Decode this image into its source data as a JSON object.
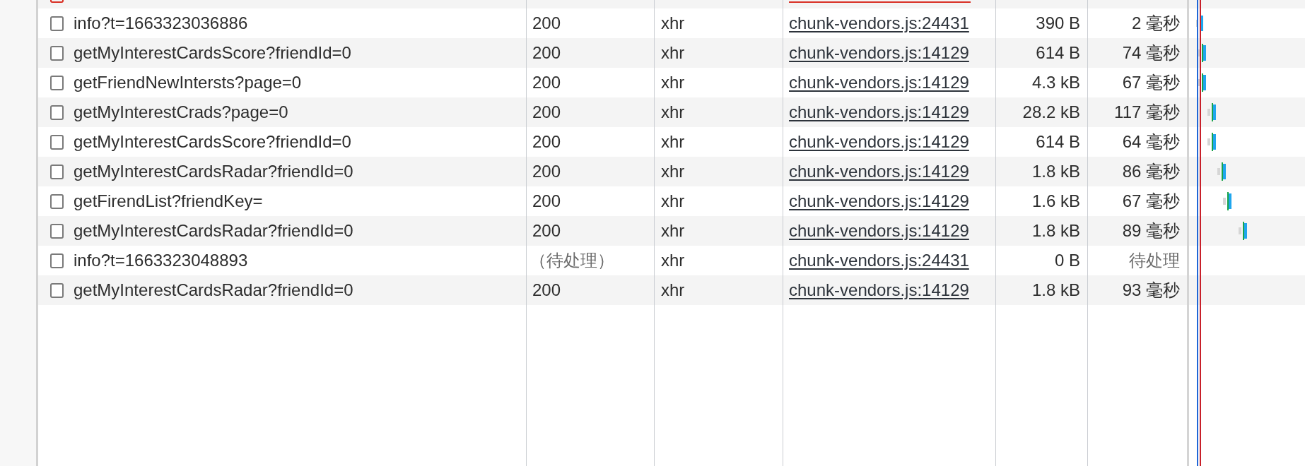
{
  "partial_row": {
    "failed": true
  },
  "requests": [
    {
      "name": "info?t=1663323036886",
      "checked": false,
      "status": "200",
      "pending": false,
      "type": "xhr",
      "initiator": "chunk-vendors.js:24431",
      "size": "390 B",
      "time": "2 毫秒"
    },
    {
      "name": "getMyInterestCardsScore?friendId=0",
      "checked": false,
      "status": "200",
      "pending": false,
      "type": "xhr",
      "initiator": "chunk-vendors.js:14129",
      "size": "614 B",
      "time": "74 毫秒"
    },
    {
      "name": "getFriendNewIntersts?page=0",
      "checked": false,
      "status": "200",
      "pending": false,
      "type": "xhr",
      "initiator": "chunk-vendors.js:14129",
      "size": "4.3 kB",
      "time": "67 毫秒"
    },
    {
      "name": "getMyInterestCrads?page=0",
      "checked": false,
      "status": "200",
      "pending": false,
      "type": "xhr",
      "initiator": "chunk-vendors.js:14129",
      "size": "28.2 kB",
      "time": "117 毫秒"
    },
    {
      "name": "getMyInterestCardsScore?friendId=0",
      "checked": false,
      "status": "200",
      "pending": false,
      "type": "xhr",
      "initiator": "chunk-vendors.js:14129",
      "size": "614 B",
      "time": "64 毫秒"
    },
    {
      "name": "getMyInterestCardsRadar?friendId=0",
      "checked": false,
      "status": "200",
      "pending": false,
      "type": "xhr",
      "initiator": "chunk-vendors.js:14129",
      "size": "1.8 kB",
      "time": "86 毫秒"
    },
    {
      "name": "getFirendList?friendKey=",
      "checked": false,
      "status": "200",
      "pending": false,
      "type": "xhr",
      "initiator": "chunk-vendors.js:14129",
      "size": "1.6 kB",
      "time": "67 毫秒"
    },
    {
      "name": "getMyInterestCardsRadar?friendId=0",
      "checked": false,
      "status": "200",
      "pending": false,
      "type": "xhr",
      "initiator": "chunk-vendors.js:14129",
      "size": "1.8 kB",
      "time": "89 毫秒"
    },
    {
      "name": "info?t=1663323048893",
      "checked": false,
      "status": "（待处理）",
      "pending": true,
      "type": "xhr",
      "initiator": "chunk-vendors.js:24431",
      "size": "0 B",
      "time": "待处理"
    },
    {
      "name": "getMyInterestCardsRadar?friendId=0",
      "checked": false,
      "status": "200",
      "pending": false,
      "type": "xhr",
      "initiator": "chunk-vendors.js:14129",
      "size": "1.8 kB",
      "time": "93 毫秒"
    }
  ]
}
